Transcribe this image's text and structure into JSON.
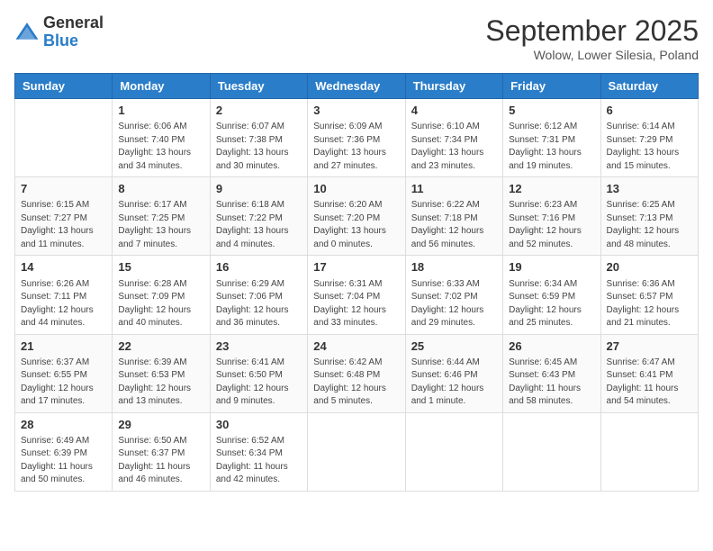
{
  "logo": {
    "general": "General",
    "blue": "Blue"
  },
  "title": "September 2025",
  "subtitle": "Wolow, Lower Silesia, Poland",
  "days_of_week": [
    "Sunday",
    "Monday",
    "Tuesday",
    "Wednesday",
    "Thursday",
    "Friday",
    "Saturday"
  ],
  "weeks": [
    [
      {
        "day": "",
        "info": ""
      },
      {
        "day": "1",
        "info": "Sunrise: 6:06 AM\nSunset: 7:40 PM\nDaylight: 13 hours\nand 34 minutes."
      },
      {
        "day": "2",
        "info": "Sunrise: 6:07 AM\nSunset: 7:38 PM\nDaylight: 13 hours\nand 30 minutes."
      },
      {
        "day": "3",
        "info": "Sunrise: 6:09 AM\nSunset: 7:36 PM\nDaylight: 13 hours\nand 27 minutes."
      },
      {
        "day": "4",
        "info": "Sunrise: 6:10 AM\nSunset: 7:34 PM\nDaylight: 13 hours\nand 23 minutes."
      },
      {
        "day": "5",
        "info": "Sunrise: 6:12 AM\nSunset: 7:31 PM\nDaylight: 13 hours\nand 19 minutes."
      },
      {
        "day": "6",
        "info": "Sunrise: 6:14 AM\nSunset: 7:29 PM\nDaylight: 13 hours\nand 15 minutes."
      }
    ],
    [
      {
        "day": "7",
        "info": "Sunrise: 6:15 AM\nSunset: 7:27 PM\nDaylight: 13 hours\nand 11 minutes."
      },
      {
        "day": "8",
        "info": "Sunrise: 6:17 AM\nSunset: 7:25 PM\nDaylight: 13 hours\nand 7 minutes."
      },
      {
        "day": "9",
        "info": "Sunrise: 6:18 AM\nSunset: 7:22 PM\nDaylight: 13 hours\nand 4 minutes."
      },
      {
        "day": "10",
        "info": "Sunrise: 6:20 AM\nSunset: 7:20 PM\nDaylight: 13 hours\nand 0 minutes."
      },
      {
        "day": "11",
        "info": "Sunrise: 6:22 AM\nSunset: 7:18 PM\nDaylight: 12 hours\nand 56 minutes."
      },
      {
        "day": "12",
        "info": "Sunrise: 6:23 AM\nSunset: 7:16 PM\nDaylight: 12 hours\nand 52 minutes."
      },
      {
        "day": "13",
        "info": "Sunrise: 6:25 AM\nSunset: 7:13 PM\nDaylight: 12 hours\nand 48 minutes."
      }
    ],
    [
      {
        "day": "14",
        "info": "Sunrise: 6:26 AM\nSunset: 7:11 PM\nDaylight: 12 hours\nand 44 minutes."
      },
      {
        "day": "15",
        "info": "Sunrise: 6:28 AM\nSunset: 7:09 PM\nDaylight: 12 hours\nand 40 minutes."
      },
      {
        "day": "16",
        "info": "Sunrise: 6:29 AM\nSunset: 7:06 PM\nDaylight: 12 hours\nand 36 minutes."
      },
      {
        "day": "17",
        "info": "Sunrise: 6:31 AM\nSunset: 7:04 PM\nDaylight: 12 hours\nand 33 minutes."
      },
      {
        "day": "18",
        "info": "Sunrise: 6:33 AM\nSunset: 7:02 PM\nDaylight: 12 hours\nand 29 minutes."
      },
      {
        "day": "19",
        "info": "Sunrise: 6:34 AM\nSunset: 6:59 PM\nDaylight: 12 hours\nand 25 minutes."
      },
      {
        "day": "20",
        "info": "Sunrise: 6:36 AM\nSunset: 6:57 PM\nDaylight: 12 hours\nand 21 minutes."
      }
    ],
    [
      {
        "day": "21",
        "info": "Sunrise: 6:37 AM\nSunset: 6:55 PM\nDaylight: 12 hours\nand 17 minutes."
      },
      {
        "day": "22",
        "info": "Sunrise: 6:39 AM\nSunset: 6:53 PM\nDaylight: 12 hours\nand 13 minutes."
      },
      {
        "day": "23",
        "info": "Sunrise: 6:41 AM\nSunset: 6:50 PM\nDaylight: 12 hours\nand 9 minutes."
      },
      {
        "day": "24",
        "info": "Sunrise: 6:42 AM\nSunset: 6:48 PM\nDaylight: 12 hours\nand 5 minutes."
      },
      {
        "day": "25",
        "info": "Sunrise: 6:44 AM\nSunset: 6:46 PM\nDaylight: 12 hours\nand 1 minute."
      },
      {
        "day": "26",
        "info": "Sunrise: 6:45 AM\nSunset: 6:43 PM\nDaylight: 11 hours\nand 58 minutes."
      },
      {
        "day": "27",
        "info": "Sunrise: 6:47 AM\nSunset: 6:41 PM\nDaylight: 11 hours\nand 54 minutes."
      }
    ],
    [
      {
        "day": "28",
        "info": "Sunrise: 6:49 AM\nSunset: 6:39 PM\nDaylight: 11 hours\nand 50 minutes."
      },
      {
        "day": "29",
        "info": "Sunrise: 6:50 AM\nSunset: 6:37 PM\nDaylight: 11 hours\nand 46 minutes."
      },
      {
        "day": "30",
        "info": "Sunrise: 6:52 AM\nSunset: 6:34 PM\nDaylight: 11 hours\nand 42 minutes."
      },
      {
        "day": "",
        "info": ""
      },
      {
        "day": "",
        "info": ""
      },
      {
        "day": "",
        "info": ""
      },
      {
        "day": "",
        "info": ""
      }
    ]
  ]
}
